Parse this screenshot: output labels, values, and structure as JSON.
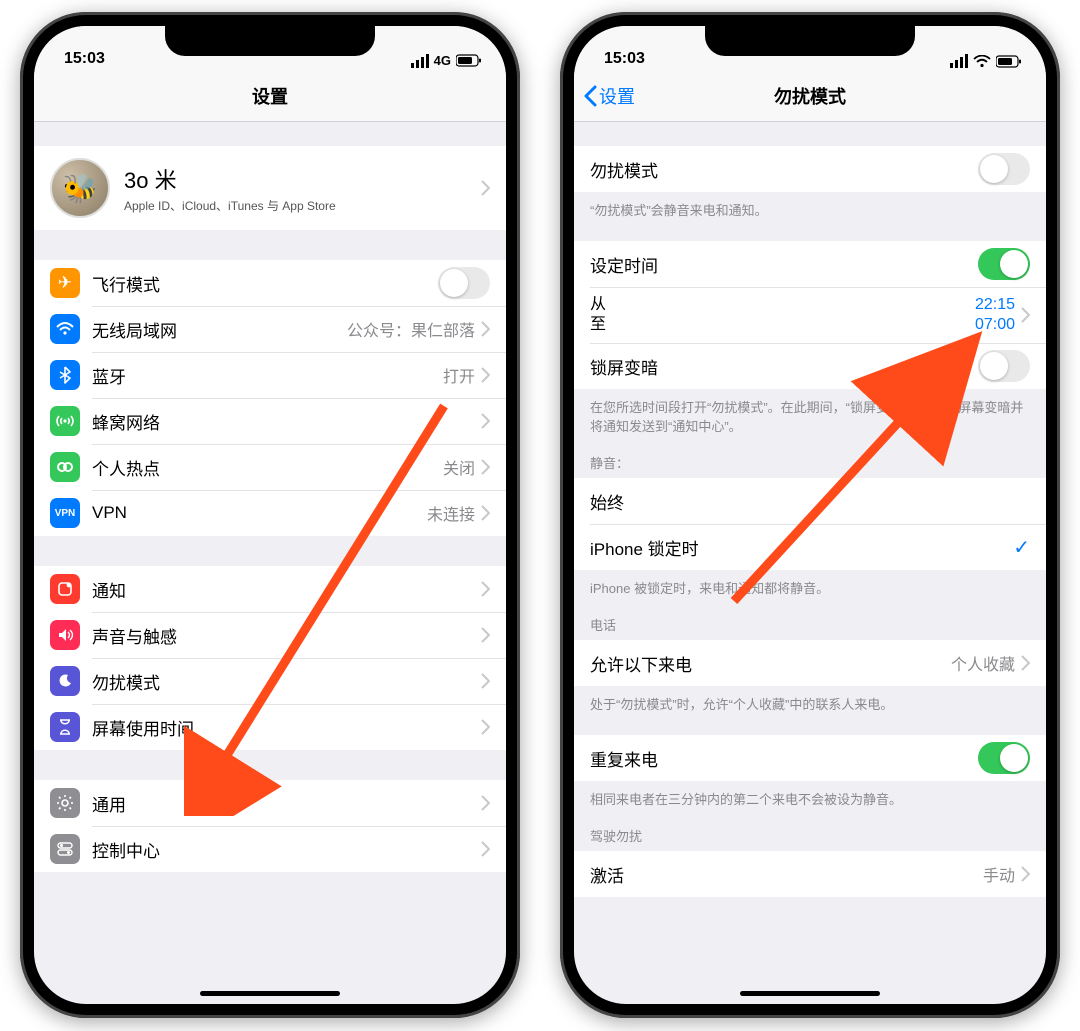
{
  "left": {
    "status": {
      "time": "15:03",
      "net": "4G"
    },
    "title": "设置",
    "profile": {
      "name": "3o 米",
      "sub": "Apple ID、iCloud、iTunes 与 App Store"
    },
    "rows": {
      "airplane": {
        "label": "飞行模式"
      },
      "wifi": {
        "label": "无线局域网",
        "value": "公众号：果仁部落"
      },
      "bluetooth": {
        "label": "蓝牙",
        "value": "打开"
      },
      "cellular": {
        "label": "蜂窝网络"
      },
      "hotspot": {
        "label": "个人热点",
        "value": "关闭"
      },
      "vpn": {
        "label": "VPN",
        "value": "未连接"
      },
      "notify": {
        "label": "通知"
      },
      "sound": {
        "label": "声音与触感"
      },
      "dnd": {
        "label": "勿扰模式"
      },
      "screentime": {
        "label": "屏幕使用时间"
      },
      "general": {
        "label": "通用"
      },
      "control": {
        "label": "控制中心"
      }
    }
  },
  "right": {
    "status": {
      "time": "15:03"
    },
    "back": "设置",
    "title": "勿扰模式",
    "rows": {
      "dnd_switch": {
        "label": "勿扰模式"
      },
      "dnd_note": "“勿扰模式”会静音来电和通知。",
      "sched": {
        "label": "设定时间"
      },
      "time_from_label": "从",
      "time_to_label": "至",
      "time_from": "22:15",
      "time_to": "07:00",
      "dim": {
        "label": "锁屏变暗"
      },
      "dim_note": "在您所选时间段打开“勿扰模式”。在此期间，“锁屏变暗”会使锁定屏幕变暗并将通知发送到“通知中心”。",
      "silence_header": "静音：",
      "always": {
        "label": "始终"
      },
      "locked": {
        "label": "iPhone 锁定时"
      },
      "locked_note": "iPhone 被锁定时，来电和通知都将静音。",
      "phone_header": "电话",
      "allow": {
        "label": "允许以下来电",
        "value": "个人收藏"
      },
      "allow_note": "处于“勿扰模式”时，允许“个人收藏”中的联系人来电。",
      "repeat": {
        "label": "重复来电"
      },
      "repeat_note": "相同来电者在三分钟内的第二个来电不会被设为静音。",
      "drive_header": "驾驶勿扰",
      "activate": {
        "label": "激活",
        "value": "手动"
      }
    }
  }
}
